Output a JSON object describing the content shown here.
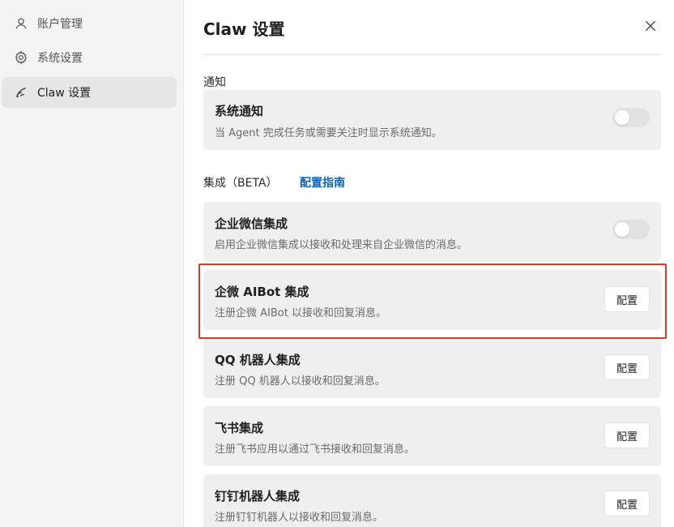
{
  "sidebar": {
    "items": [
      {
        "label": "账户管理",
        "icon": "user-icon"
      },
      {
        "label": "系统设置",
        "icon": "gear-icon"
      },
      {
        "label": "Claw 设置",
        "icon": "claw-icon"
      }
    ]
  },
  "header": {
    "title": "Claw 设置"
  },
  "sections": {
    "notify": {
      "label": "通知"
    },
    "integration": {
      "label": "集成（BETA）",
      "link": "配置指南"
    }
  },
  "cards": {
    "system_notify": {
      "title": "系统通知",
      "desc": "当 Agent 完成任务或需要关注时显示系统通知。",
      "enabled": false
    },
    "wecom": {
      "title": "企业微信集成",
      "desc": "启用企业微信集成以接收和处理来自企业微信的消息。",
      "enabled": false
    },
    "wecom_aibot": {
      "title": "企微 AIBot 集成",
      "desc": "注册企微 AIBot 以接收和回复消息。",
      "button": "配置"
    },
    "qq": {
      "title": "QQ 机器人集成",
      "desc": "注册 QQ 机器人以接收和回复消息。",
      "button": "配置"
    },
    "feishu": {
      "title": "飞书集成",
      "desc": "注册飞书应用以通过飞书接收和回复消息。",
      "button": "配置"
    },
    "dingtalk": {
      "title": "钉钉机器人集成",
      "desc": "注册钉钉机器人以接收和回复消息。",
      "button": "配置"
    }
  },
  "colors": {
    "highlight": "#d63a2a",
    "link": "#0b63b6"
  }
}
